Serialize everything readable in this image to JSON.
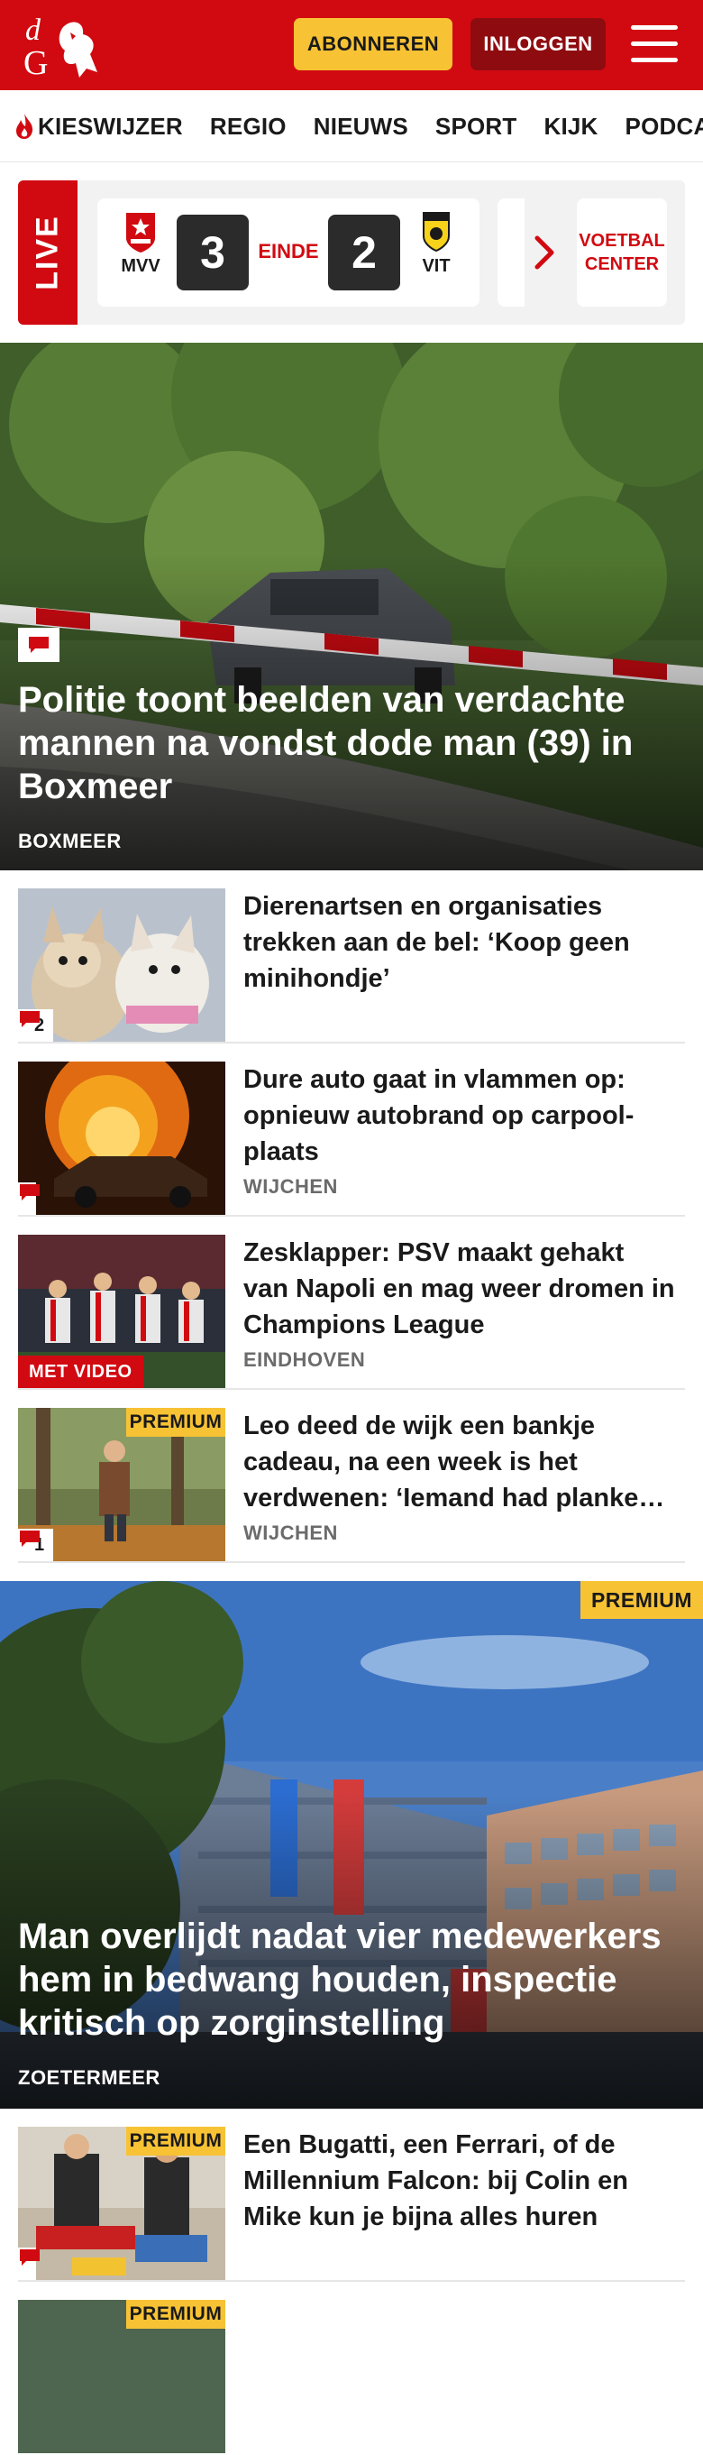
{
  "header": {
    "logo_text": "dG",
    "subscribe_label": "ABONNEREN",
    "login_label": "INLOGGEN",
    "menu_icon": "hamburger-menu-icon",
    "brand_color": "#d10a11"
  },
  "nav": {
    "items": [
      {
        "label": "KIESWIJZER",
        "icon": "flame-icon"
      },
      {
        "label": "REGIO"
      },
      {
        "label": "NIEUWS"
      },
      {
        "label": "SPORT"
      },
      {
        "label": "KIJK"
      },
      {
        "label": "PODCAS"
      }
    ]
  },
  "live": {
    "tag": "LIVE",
    "match": {
      "home_code": "MVV",
      "home_score": "3",
      "status": "EINDE",
      "away_score": "2",
      "away_code": "VIT"
    },
    "voetbal_center_label": "VOETBAL CENTER"
  },
  "hero1": {
    "title": "Politie toont beelden van verdachte mannen na vondst dode man (39) in Boxmeer",
    "location": "BOXMEER",
    "icon": "comment-icon"
  },
  "articles1": [
    {
      "title": "Dierenartsen en organisaties trekken aan de bel: ‘Koop geen minihondje’",
      "location": "",
      "comments": "2",
      "badge": ""
    },
    {
      "title": "Dure auto gaat in vlammen op: opnieuw autobrand op carpool-plaats",
      "location": "WIJCHEN",
      "comments": "",
      "badge": ""
    },
    {
      "title": "Zesklapper: PSV maakt gehakt van Napoli en mag weer dromen in Champions League",
      "location": "EINDHOVEN",
      "video": "MET VIDEO",
      "badge": ""
    },
    {
      "title": "Leo deed de wijk een bankje cadeau, na een week is het verdwenen: ‘Iemand had planke…",
      "location": "WIJCHEN",
      "comments": "1",
      "badge": "PREMIUM"
    }
  ],
  "hero2": {
    "badge": "PREMIUM",
    "title": "Man overlijdt nadat vier medewerkers hem in bedwang houden, inspectie kritisch op zorginstelling",
    "location": "ZOETERMEER"
  },
  "articles2": [
    {
      "title": "Een Bugatti, een Ferrari, of de Millennium Falcon: bij Colin en Mike kun je bijna alles huren",
      "location": "",
      "badge": "PREMIUM"
    },
    {
      "title": "",
      "location": "",
      "badge": "PREMIUM"
    }
  ]
}
